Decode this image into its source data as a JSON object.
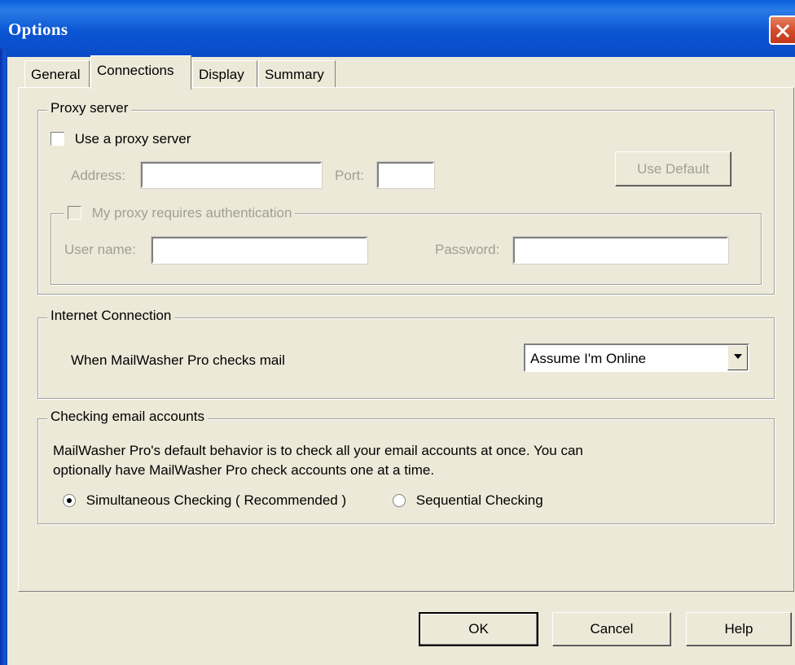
{
  "window": {
    "title": "Options"
  },
  "tabs": [
    {
      "label": "General",
      "active": false
    },
    {
      "label": "Connections",
      "active": true
    },
    {
      "label": "Display",
      "active": false
    },
    {
      "label": "Summary",
      "active": false
    }
  ],
  "proxy": {
    "group_label": "Proxy server",
    "use_proxy_label": "Use a proxy server",
    "use_proxy_checked": false,
    "address_label": "Address:",
    "address_value": "",
    "port_label": "Port:",
    "port_value": "",
    "use_default_label": "Use Default",
    "auth_label": "My proxy requires authentication",
    "auth_checked": false,
    "username_label": "User name:",
    "username_value": "",
    "password_label": "Password:",
    "password_value": ""
  },
  "internet": {
    "group_label": "Internet Connection",
    "prompt": "When MailWasher Pro checks mail",
    "selected_option": "Assume I'm Online"
  },
  "checking": {
    "group_label": "Checking email accounts",
    "description_line1": "MailWasher Pro's default behavior is to check all your email accounts at once. You can",
    "description_line2": "optionally have MailWasher Pro check accounts one at a time.",
    "option_simultaneous": "Simultaneous Checking ( Recommended )",
    "option_sequential": "Sequential Checking",
    "selected": "simultaneous"
  },
  "footer": {
    "ok_label": "OK",
    "cancel_label": "Cancel",
    "help_label": "Help"
  },
  "colors": {
    "titlebar": "#0a55d2",
    "dialog_bg": "#ece9d8",
    "close_button": "#d3492a",
    "disabled_text": "#a09f97"
  }
}
